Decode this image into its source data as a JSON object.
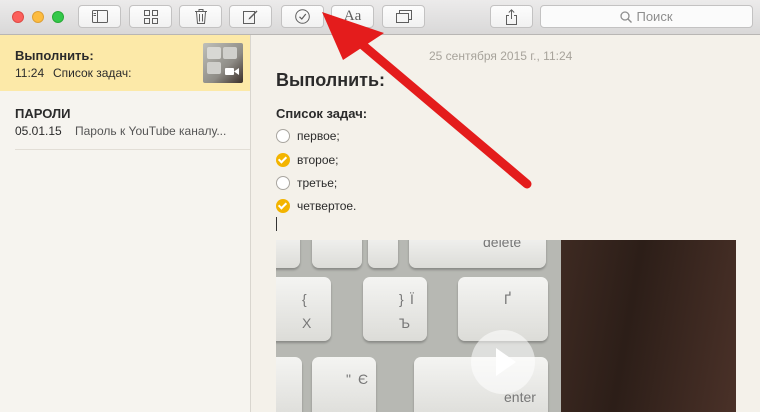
{
  "toolbar": {
    "search_placeholder": "Поиск",
    "buttons": [
      "sidebar-toggle",
      "attachments-browser",
      "delete-note",
      "new-note",
      "checklist",
      "format",
      "add-photo",
      "share"
    ],
    "format_label": "Aa"
  },
  "sidebar": {
    "notes": [
      {
        "title": "Выполнить:",
        "time": "11:24",
        "preview": "Список задач:",
        "selected": true,
        "has_video_thumb": true
      },
      {
        "title": "ПАРОЛИ",
        "time": "05.01.15",
        "preview": "Пароль к YouTube каналу...",
        "selected": false
      }
    ]
  },
  "editor": {
    "date": "25 сентября 2015 г., 11:24",
    "title": "Выполнить:",
    "list_heading": "Список задач:",
    "checklist": [
      {
        "text": "первое;",
        "done": false
      },
      {
        "text": "второе;",
        "done": true
      },
      {
        "text": "третье;",
        "done": false
      },
      {
        "text": "четвертое.",
        "done": true
      }
    ],
    "video_keys": {
      "delete": "delete",
      "enter": "enter",
      "brace_open": "{",
      "cyr_kh": "Х",
      "brace_close": "}",
      "i_ukr": "Ї",
      "cyr_hard": "Ъ",
      "ghe": "Ґ",
      "quote": "\"",
      "ye": "Є"
    }
  },
  "colors": {
    "accent": "#f3b400",
    "selection": "#fce9a8",
    "arrow": "#e41c1c"
  }
}
